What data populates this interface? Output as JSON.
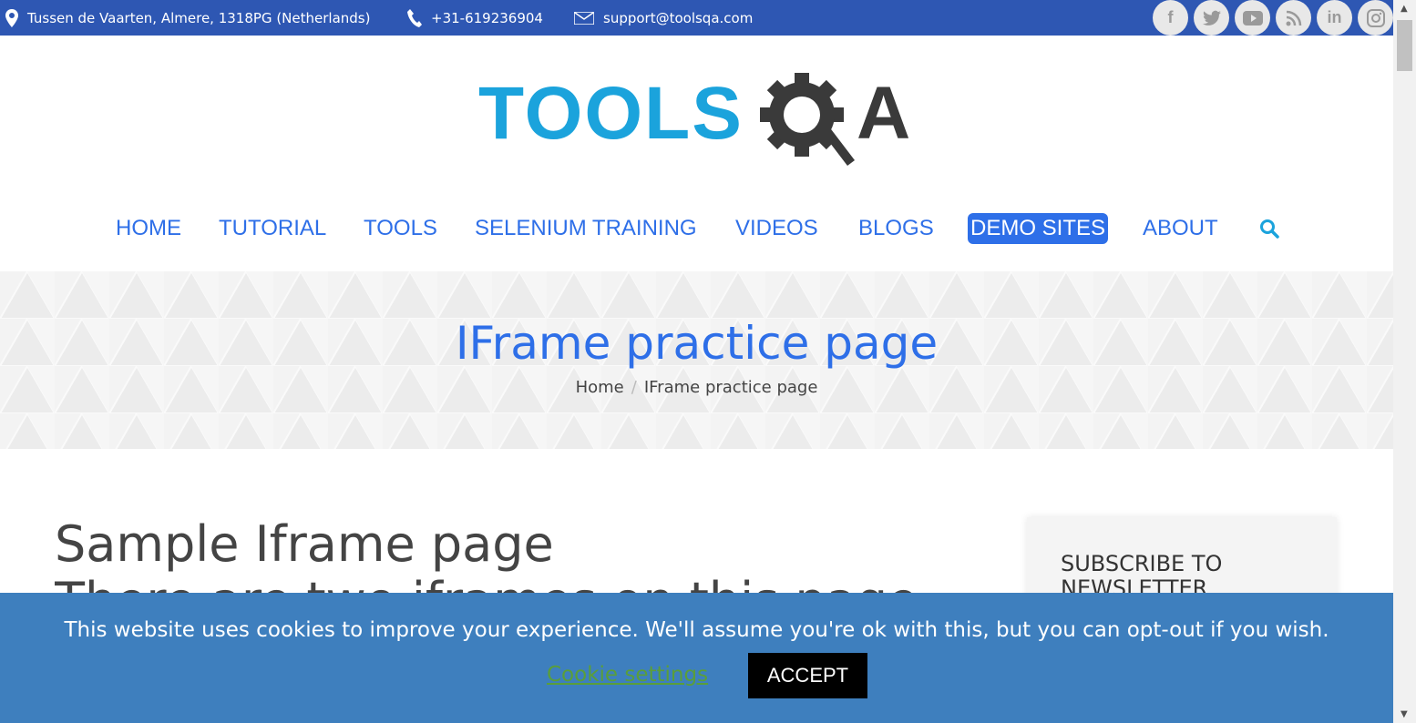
{
  "topbar": {
    "address": "Tussen de Vaarten, Almere, 1318PG (Netherlands)",
    "phone": "+31-619236904",
    "email": "support@toolsqa.com",
    "social": [
      "f",
      "t",
      "▶",
      "rss",
      "in",
      "ig"
    ]
  },
  "logo": {
    "tools": "TOOLS",
    "a": "A"
  },
  "nav": {
    "items": [
      "HOME",
      "TUTORIAL",
      "TOOLS",
      "SELENIUM TRAINING",
      "VIDEOS",
      "BLOGS",
      "DEMO SITES",
      "ABOUT"
    ],
    "active": "DEMO SITES"
  },
  "hero": {
    "title": "IFrame practice page",
    "breadcrumb_home": "Home",
    "breadcrumb_current": "IFrame practice page"
  },
  "content": {
    "heading": "Sample Iframe page",
    "subheading": "There are two iframes on this page"
  },
  "sidebar": {
    "title": "SUBSCRIBE TO NEWSLETTER"
  },
  "cookie": {
    "message": "This website uses cookies to improve your experience. We'll assume you're ok with this, but you can opt-out if you wish.",
    "settings": "Cookie settings",
    "accept": "ACCEPT"
  },
  "colors": {
    "topbar": "#2e57b3",
    "link": "#2e6fe8",
    "cookie_bg": "#3e7fbe",
    "logo_blue": "#1ba3dc"
  }
}
